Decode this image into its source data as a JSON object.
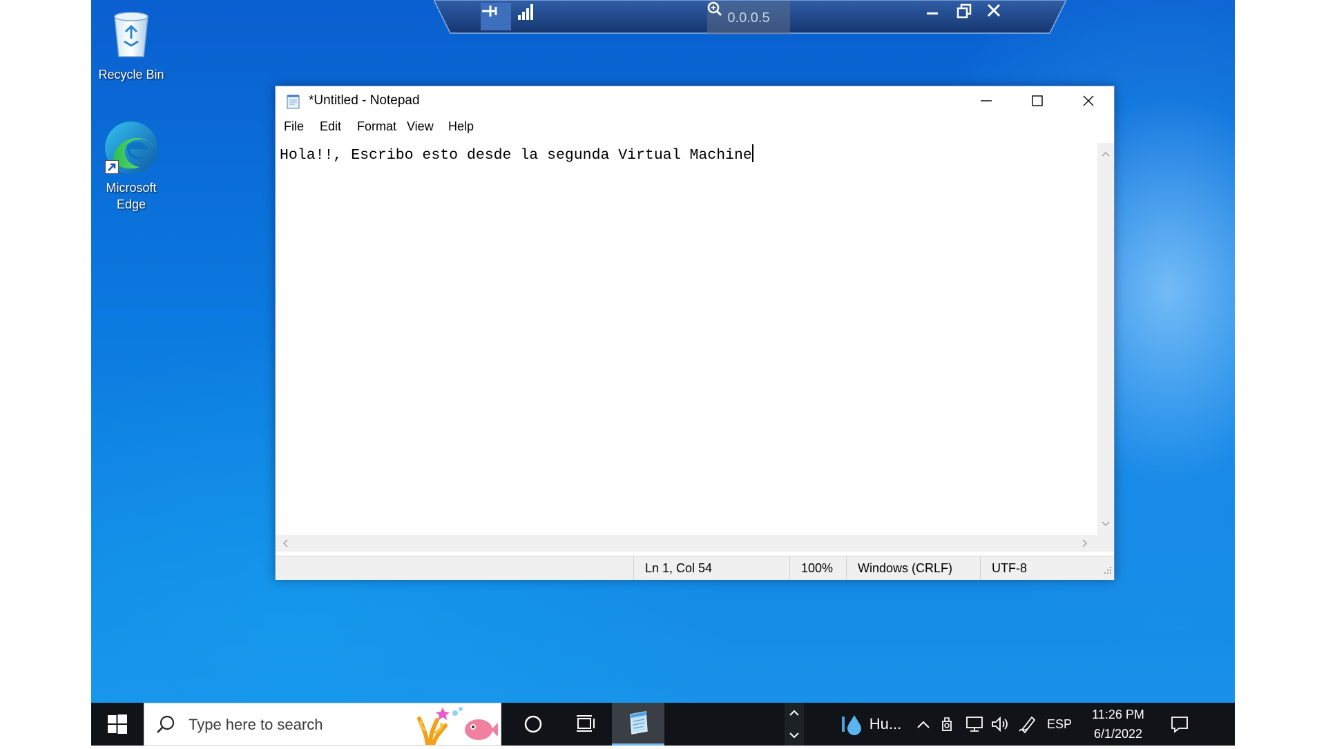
{
  "desktop": {
    "icons": [
      {
        "label": "Recycle Bin",
        "icon": "recycle-bin-icon"
      },
      {
        "label": "Microsoft Edge",
        "icon": "edge-icon"
      }
    ]
  },
  "rdp_bar": {
    "connection_name": "0.0.0.5",
    "buttons": [
      "pin-icon",
      "signal-icon",
      "zoom-icon",
      "minimize-icon",
      "restore-icon",
      "close-icon"
    ]
  },
  "notepad": {
    "title": "*Untitled - Notepad",
    "menu": [
      "File",
      "Edit",
      "Format",
      "View",
      "Help"
    ],
    "content": "Hola!!, Escribo esto desde la segunda Virtual Machine",
    "status": {
      "position": "Ln 1, Col 54",
      "zoom": "100%",
      "line_ending": "Windows (CRLF)",
      "encoding": "UTF-8"
    }
  },
  "taskbar": {
    "search_placeholder": "Type here to search",
    "weather_text": "Hu...",
    "language": "ESP",
    "time": "11:26 PM",
    "date": "6/1/2022"
  },
  "colors": {
    "desktop_blue": "#0b7be0",
    "taskbar_bg": "#101418",
    "active_task_underline": "#76b9ed"
  }
}
